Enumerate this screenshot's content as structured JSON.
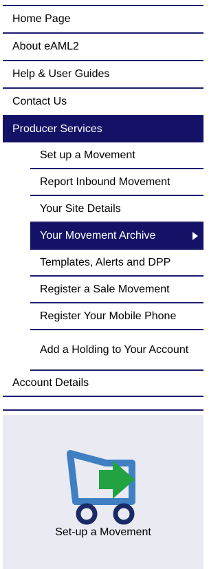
{
  "nav": {
    "top_items": [
      {
        "label": "Home Page"
      },
      {
        "label": "About eAML2"
      },
      {
        "label": "Help & User Guides"
      },
      {
        "label": "Contact Us"
      }
    ],
    "producer_services": {
      "label": "Producer Services",
      "sub_items": [
        {
          "label": "Set up a Movement"
        },
        {
          "label": "Report Inbound Movement"
        },
        {
          "label": "Your Site Details"
        },
        {
          "label": "Your Movement Archive"
        },
        {
          "label": "Templates, Alerts and DPP"
        },
        {
          "label": "Register a Sale Movement"
        },
        {
          "label": "Register Your Mobile Phone"
        },
        {
          "label": "Add a Holding to Your Account"
        }
      ]
    },
    "account_details": {
      "label": "Account Details"
    }
  },
  "promo": {
    "label": "Set-up a Movement",
    "icon": "truck-with-arrow-icon"
  },
  "colors": {
    "nav_active": "#141266",
    "border": "#1c1c6e",
    "promo_bg": "#eaeaf3",
    "truck_blue": "#3f7fc2",
    "truck_wheels": "#1a2a66",
    "arrow_green": "#22a342"
  }
}
